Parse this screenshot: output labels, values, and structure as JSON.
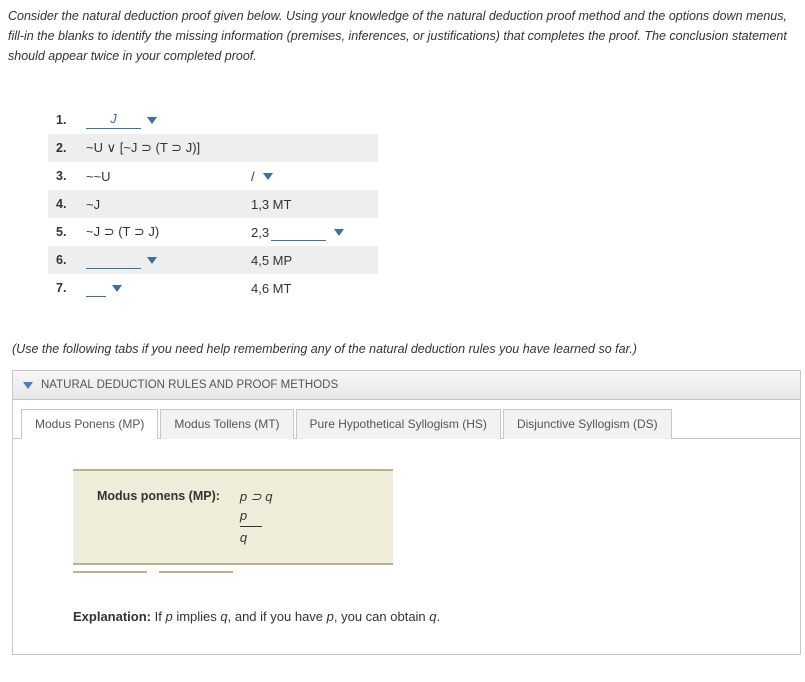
{
  "instructions": "Consider the natural deduction proof given below. Using your knowledge of the natural deduction proof method and the options down menus, fill-in the blanks to identify the missing information (premises, inferences, or justifications) that completes the proof. The conclusion statement should appear twice in your completed proof.",
  "proof": {
    "rows": [
      {
        "num": "1.",
        "formula_blank": "J",
        "formula": "",
        "justif_pre": "",
        "justif_blank": "",
        "has_dd_after_formula": true,
        "has_dd_after_justif": false
      },
      {
        "num": "2.",
        "formula_blank": "",
        "formula": "~U ∨ [~J ⊃ (T ⊃ J)]",
        "justif_pre": "",
        "justif_blank": "",
        "has_dd_after_formula": false,
        "has_dd_after_justif": false,
        "alt": true
      },
      {
        "num": "3.",
        "formula_blank": "",
        "formula": "~~U",
        "justif_pre": "/ ",
        "justif_blank": "",
        "has_dd_after_formula": false,
        "has_dd_after_justif": true
      },
      {
        "num": "4.",
        "formula_blank": "",
        "formula": "~J",
        "justif_pre": "1,3 MT",
        "justif_blank": "",
        "has_dd_after_formula": false,
        "has_dd_after_justif": false,
        "alt": true
      },
      {
        "num": "5.",
        "formula_blank": "",
        "formula": "~J ⊃ (T ⊃ J)",
        "justif_pre": "2,3 ",
        "justif_blank": "",
        "has_dd_after_formula": false,
        "has_dd_after_justif": true,
        "blank_in_justif": true
      },
      {
        "num": "6.",
        "formula_blank": "",
        "formula": "",
        "justif_pre": "4,5 MP",
        "justif_blank": "",
        "has_dd_after_formula": true,
        "has_dd_after_justif": false,
        "blank_in_formula": true,
        "alt": true
      },
      {
        "num": "7.",
        "formula_blank": "",
        "formula": "",
        "justif_pre": "4,6 MT",
        "justif_blank": "",
        "has_dd_after_formula": true,
        "has_dd_after_justif": false,
        "blank_in_formula_short": true
      }
    ]
  },
  "hint": "(Use the following tabs if you need help remembering any of the natural deduction rules you have learned so far.)",
  "rulesPanel": {
    "header": "NATURAL DEDUCTION RULES AND PROOF METHODS",
    "tabs": [
      {
        "label": "Modus Ponens (MP)",
        "active": true
      },
      {
        "label": "Modus Tollens (MT)",
        "active": false
      },
      {
        "label": "Pure Hypothetical Syllogism (HS)",
        "active": false
      },
      {
        "label": "Disjunctive Syllogism (DS)",
        "active": false
      }
    ],
    "ruleBox": {
      "name": "Modus ponens (MP):",
      "line1": "p ⊃ q",
      "line2": "p",
      "line3": "q"
    },
    "explanation_label": "Explanation:",
    "explanation_text": " If p implies q, and if you have p, you can obtain q."
  }
}
